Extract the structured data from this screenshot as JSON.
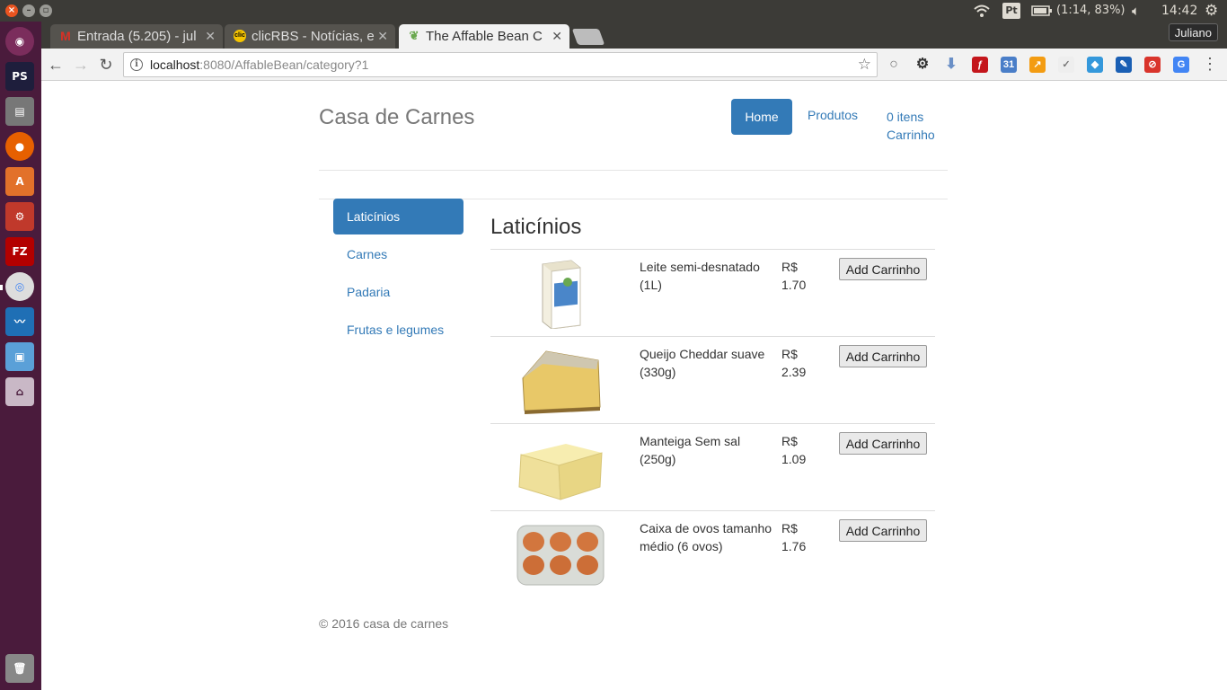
{
  "system": {
    "tray_input": "Pt",
    "battery": "(1:14, 83%)",
    "clock": "14:42"
  },
  "tabs": [
    {
      "label": "Entrada (5.205) - jul",
      "icon": "gmail-icon"
    },
    {
      "label": "clicRBS - Notícias, e",
      "icon": "clic-icon"
    },
    {
      "label": "The Affable Bean C",
      "icon": "affable-bean-icon"
    }
  ],
  "profile": "Juliano",
  "address": {
    "host": "localhost",
    "path": ":8080/AffableBean/category?1"
  },
  "site": {
    "brand": "Casa de Carnes",
    "nav": {
      "home": "Home",
      "produtos": "Produtos",
      "cart_count": "0 itens",
      "cart_label": "Carrinho"
    },
    "categories": [
      "Laticínios",
      "Carnes",
      "Padaria",
      "Frutas e legumes"
    ],
    "active_category": "Laticínios",
    "products": [
      {
        "name": "Leite semi-desnatado (1L)",
        "currency": "R$",
        "price": "1.70",
        "button": "Add Carrinho",
        "image": "milk-carton"
      },
      {
        "name": "Queijo Cheddar suave (330g)",
        "currency": "R$",
        "price": "2.39",
        "button": "Add Carrinho",
        "image": "cheese-wedge"
      },
      {
        "name": "Manteiga Sem sal (250g)",
        "currency": "R$",
        "price": "1.09",
        "button": "Add Carrinho",
        "image": "butter-block"
      },
      {
        "name": "Caixa de ovos tamanho médio (6 ovos)",
        "currency": "R$",
        "price": "1.76",
        "button": "Add Carrinho",
        "image": "egg-carton"
      }
    ],
    "footer": "© 2016 casa de carnes"
  },
  "colors": {
    "primary": "#337ab7",
    "launcher": "#4a1b3c",
    "panel": "#3c3b37"
  }
}
